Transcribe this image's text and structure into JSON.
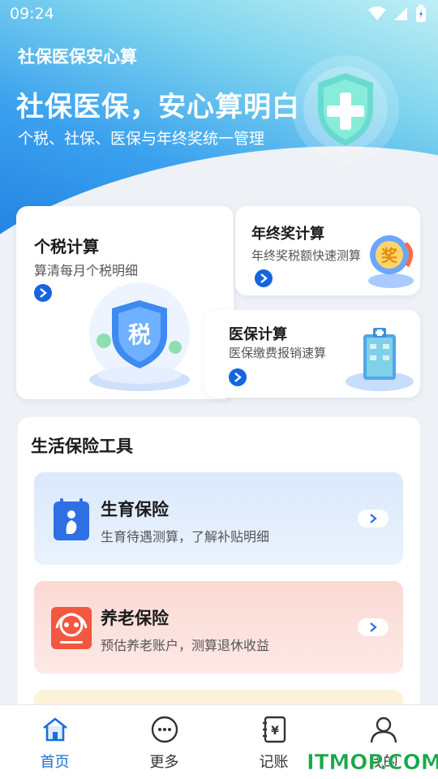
{
  "status_bar": {
    "time": "09:24"
  },
  "hero": {
    "app_title": "社保医保安心算",
    "headline": "社保医保，安心算明白",
    "subline": "个税、社保、医保与年终奖统一管理"
  },
  "cards": {
    "tax": {
      "title": "个税计算",
      "subtitle": "算清每月个税明细",
      "badge": "税"
    },
    "bonus": {
      "title": "年终奖计算",
      "subtitle": "年终奖税额快速测算",
      "badge": "奖"
    },
    "medical": {
      "title": "医保计算",
      "subtitle": "医保缴费报销速算"
    }
  },
  "tools": {
    "title": "生活保险工具",
    "items": [
      {
        "name": "生育保险",
        "desc": "生育待遇测算，了解补贴明细"
      },
      {
        "name": "养老保险",
        "desc": "预估养老账户，测算退休收益"
      }
    ]
  },
  "tabbar": {
    "tabs": [
      {
        "label": "首页"
      },
      {
        "label": "更多"
      },
      {
        "label": "记账"
      },
      {
        "label": "我的"
      }
    ]
  },
  "watermark": "ITMOP.COM",
  "colors": {
    "accent": "#1565e0",
    "tab_active": "#1a6fd8",
    "maternity_icon": "#2f6fe4",
    "pension_icon": "#f2573f"
  }
}
